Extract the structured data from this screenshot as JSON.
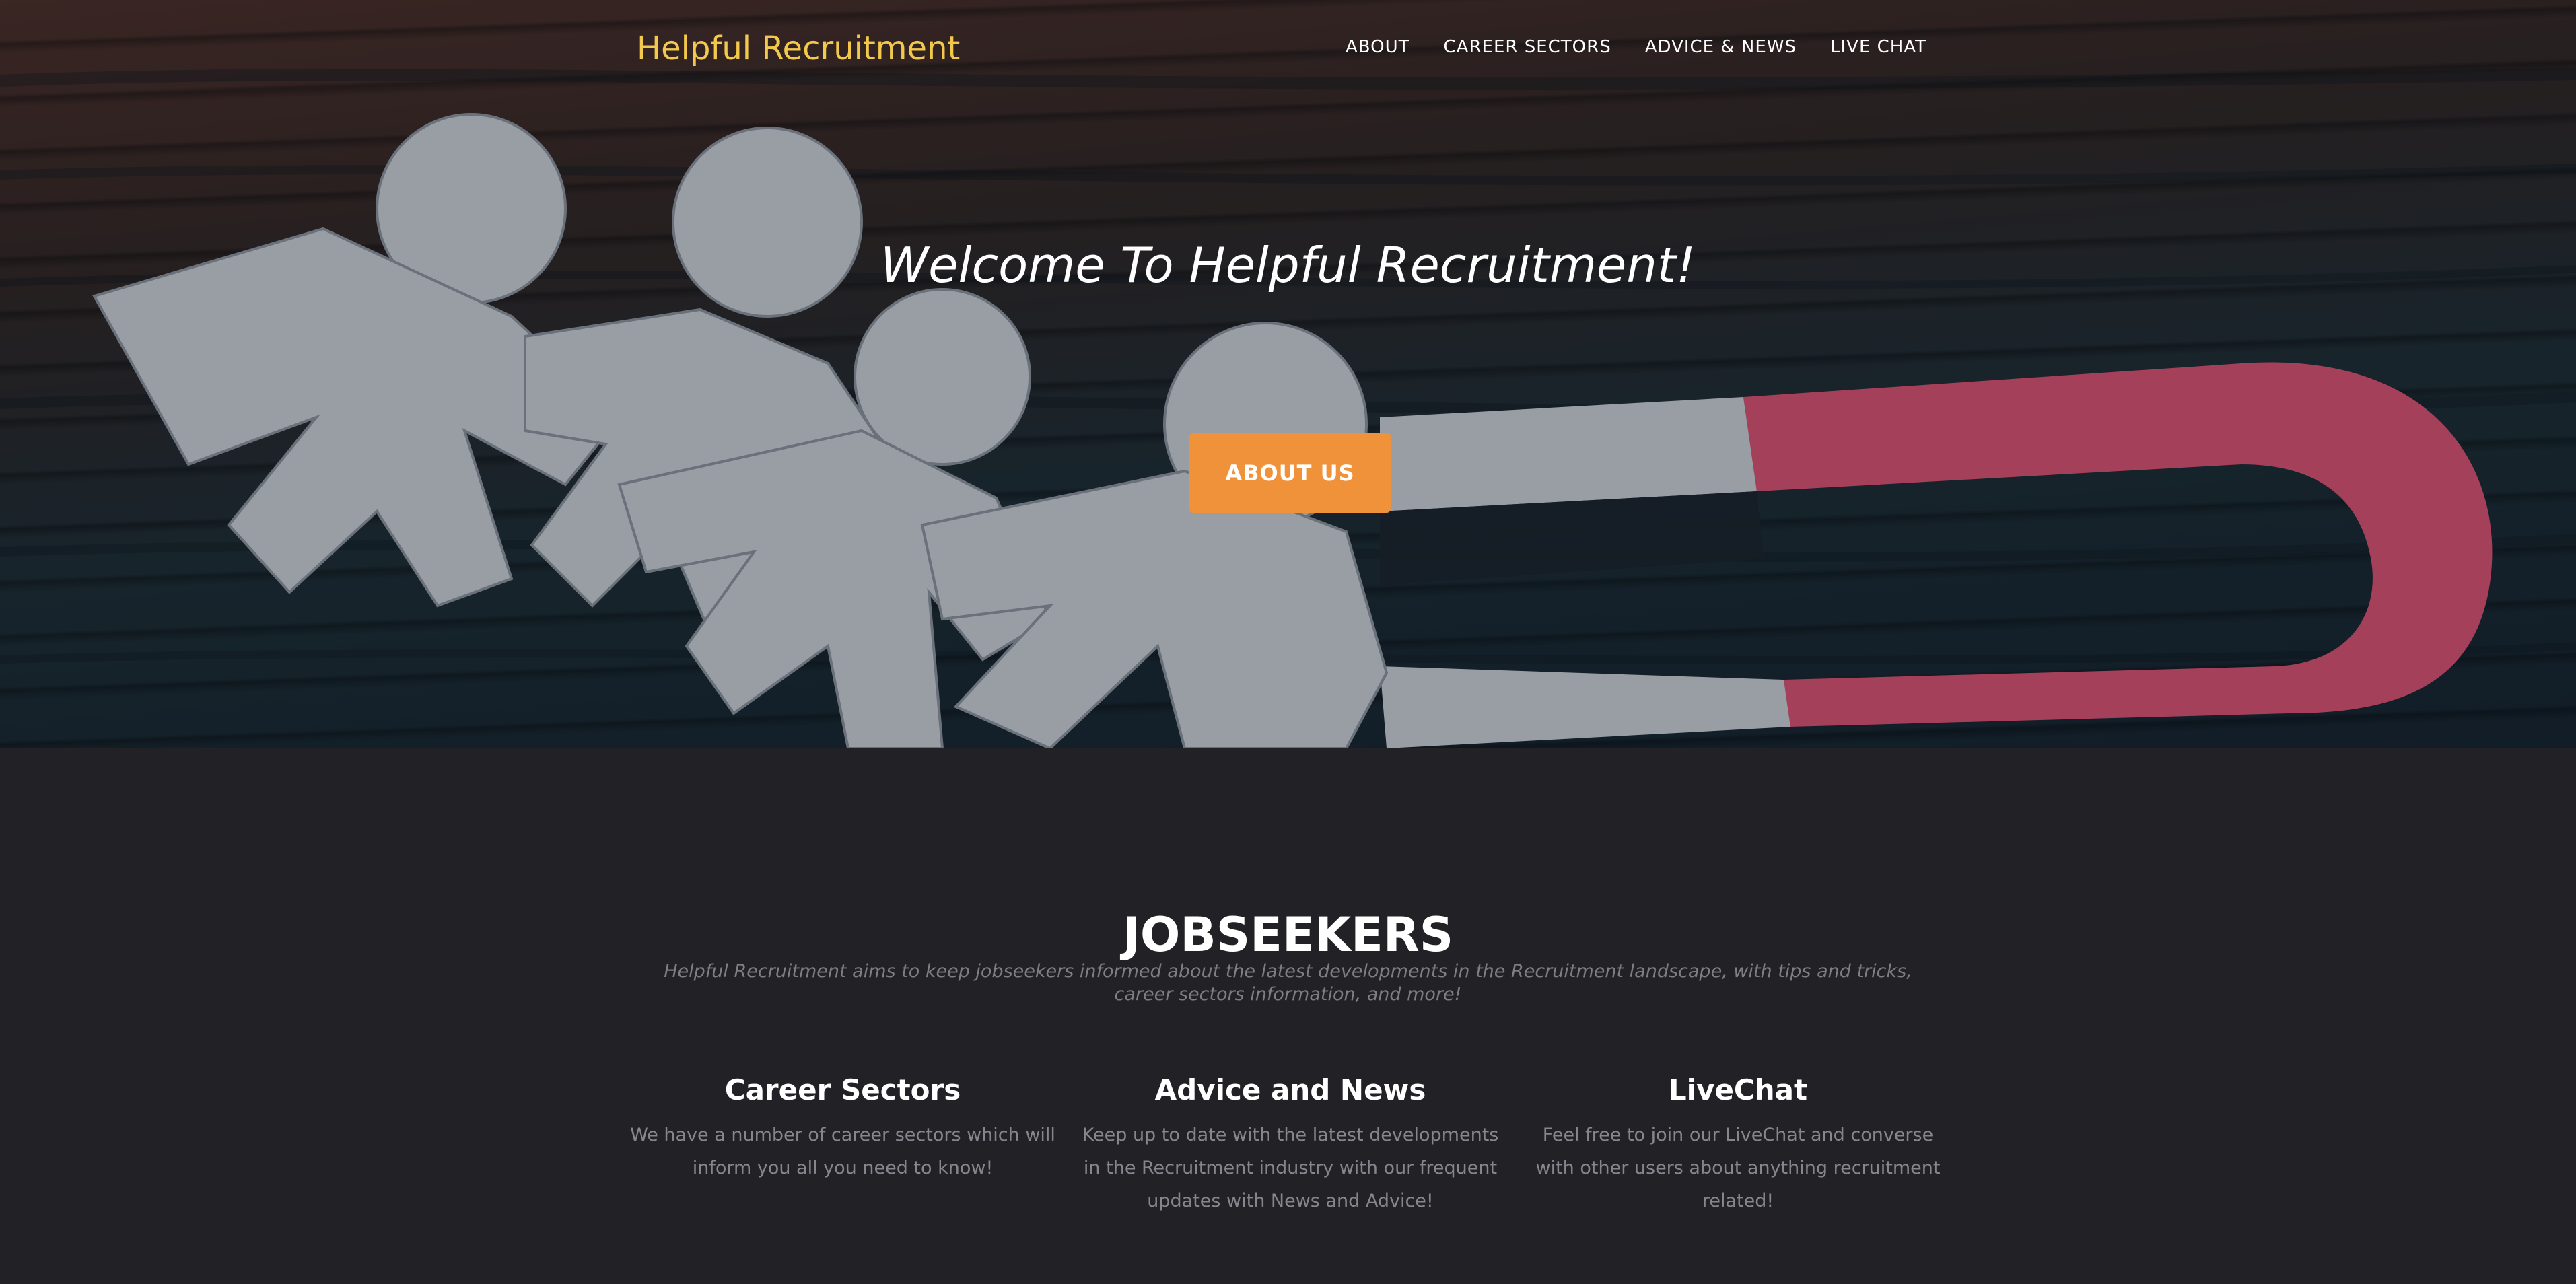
{
  "header": {
    "brand": "Helpful Recruitment",
    "nav": [
      "ABOUT",
      "CAREER SECTORS",
      "ADVICE & NEWS",
      "LIVE CHAT"
    ]
  },
  "hero": {
    "welcome": "Welcome To Helpful Recruitment!",
    "button": "ABOUT US",
    "image_subject": "paper people cutouts attracted by a horseshoe magnet on wood"
  },
  "jobseekers": {
    "title": "JOBSEEKERS",
    "description": "Helpful Recruitment aims to keep jobseekers informed about the latest developments in the Recruitment landscape, with tips and tricks, career sectors information, and more!",
    "features": [
      {
        "title": "Career Sectors",
        "text": "We have a number of career sectors which will inform you all you need to know!"
      },
      {
        "title": "Advice and News",
        "text": "Keep up to date with the latest developments in the Recruitment industry with our frequent updates with News and Advice!"
      },
      {
        "title": "LiveChat",
        "text": "Feel free to join our LiveChat and converse with other users about anything recruitment related!"
      }
    ]
  },
  "colors": {
    "brand": "#f2c94c",
    "accent_button": "#f0923a",
    "background": "#222226",
    "magnet_red": "#d94f6e"
  }
}
